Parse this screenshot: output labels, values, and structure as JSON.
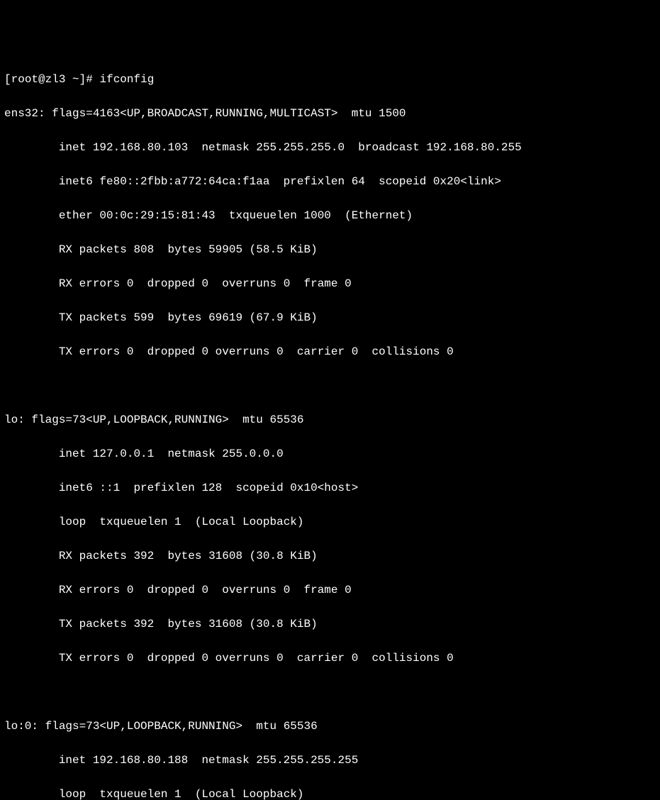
{
  "prompt": {
    "user": "root",
    "host": "zl3",
    "path": "~",
    "symbol": "#",
    "command": "ifconfig"
  },
  "interfaces": [
    {
      "name": "ens32",
      "flags_num": "4163",
      "flags_list": "UP,BROADCAST,RUNNING,MULTICAST",
      "mtu": "1500",
      "inet": "192.168.80.103",
      "netmask": "255.255.255.0",
      "broadcast": "192.168.80.255",
      "inet6": "fe80::2fbb:a772:64ca:f1aa",
      "prefixlen": "64",
      "scopeid": "0x20",
      "scope_label": "link",
      "ether": "00:0c:29:15:81:43",
      "txqueuelen": "1000",
      "hwtype": "Ethernet",
      "rx_packets": "808",
      "rx_bytes": "59905",
      "rx_bytes_h": "58.5 KiB",
      "rx_errors": "0",
      "rx_dropped": "0",
      "rx_overruns": "0",
      "rx_frame": "0",
      "tx_packets": "599",
      "tx_bytes": "69619",
      "tx_bytes_h": "67.9 KiB",
      "tx_errors": "0",
      "tx_dropped": "0",
      "tx_overruns": "0",
      "tx_carrier": "0",
      "tx_collisions": "0"
    },
    {
      "name": "lo",
      "flags_num": "73",
      "flags_list": "UP,LOOPBACK,RUNNING",
      "mtu": "65536",
      "inet": "127.0.0.1",
      "netmask": "255.0.0.0",
      "inet6": "::1",
      "prefixlen": "128",
      "scopeid": "0x10",
      "scope_label": "host",
      "loop_txqueuelen": "1",
      "hwtype": "Local Loopback",
      "rx_packets": "392",
      "rx_bytes": "31608",
      "rx_bytes_h": "30.8 KiB",
      "rx_errors": "0",
      "rx_dropped": "0",
      "rx_overruns": "0",
      "rx_frame": "0",
      "tx_packets": "392",
      "tx_bytes": "31608",
      "tx_bytes_h": "30.8 KiB",
      "tx_errors": "0",
      "tx_dropped": "0",
      "tx_overruns": "0",
      "tx_carrier": "0",
      "tx_collisions": "0"
    },
    {
      "name": "lo:0",
      "flags_num": "73",
      "flags_list": "UP,LOOPBACK,RUNNING",
      "mtu": "65536",
      "inet": "192.168.80.188",
      "netmask": "255.255.255.255",
      "loop_txqueuelen": "1",
      "hwtype": "Local Loopback"
    }
  ]
}
